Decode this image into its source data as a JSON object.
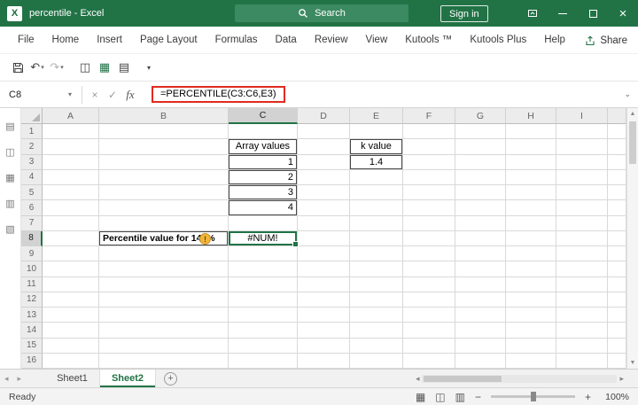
{
  "title_bar": {
    "app_icon_letter": "X",
    "title": "percentile - Excel",
    "search_label": "Search",
    "sign_in_label": "Sign in"
  },
  "ribbon": {
    "tabs": [
      "File",
      "Home",
      "Insert",
      "Page Layout",
      "Formulas",
      "Data",
      "Review",
      "View",
      "Kutools ™",
      "Kutools Plus",
      "Help"
    ],
    "share_label": "Share"
  },
  "formula_bar": {
    "name_box": "C8",
    "cancel_glyph": "×",
    "enter_glyph": "✓",
    "fx_label": "fx",
    "formula": "=PERCENTILE(C3:C6,E3)"
  },
  "grid": {
    "column_headers": [
      "A",
      "B",
      "C",
      "D",
      "E",
      "F",
      "G",
      "H",
      "I"
    ],
    "row_headers": [
      "1",
      "2",
      "3",
      "4",
      "5",
      "6",
      "7",
      "8",
      "9",
      "10",
      "11",
      "12",
      "13",
      "14",
      "15",
      "16"
    ],
    "selected_cell": "C8",
    "selected_column": "C",
    "selected_row": "8",
    "cells": [
      {
        "ref": "C2",
        "text": "Array values",
        "align": "center",
        "boxed": true
      },
      {
        "ref": "C3",
        "text": "1",
        "align": "right",
        "boxed": true
      },
      {
        "ref": "C4",
        "text": "2",
        "align": "right",
        "boxed": true
      },
      {
        "ref": "C5",
        "text": "3",
        "align": "right",
        "boxed": true
      },
      {
        "ref": "C6",
        "text": "4",
        "align": "right",
        "boxed": true
      },
      {
        "ref": "E2",
        "text": "k value",
        "align": "center",
        "boxed": true
      },
      {
        "ref": "E3",
        "text": "1.4",
        "align": "center",
        "boxed": true
      },
      {
        "ref": "B8",
        "text": "Percentile value for 140%",
        "align": "left",
        "boxed": true,
        "bold": true
      },
      {
        "ref": "C8",
        "text": "#NUM!",
        "align": "center",
        "selected": true
      }
    ],
    "error_tag_glyph": "!"
  },
  "sheet_tabs": {
    "tabs": [
      {
        "label": "Sheet1",
        "active": false
      },
      {
        "label": "Sheet2",
        "active": true
      }
    ]
  },
  "status_bar": {
    "status_label": "Ready",
    "zoom_level": "100%"
  },
  "colors": {
    "excel_green": "#217346",
    "annotation_red": "#e02b20",
    "selected_header_fill": "#d2d2d2",
    "error_tag_fill": "#f2b63c"
  }
}
